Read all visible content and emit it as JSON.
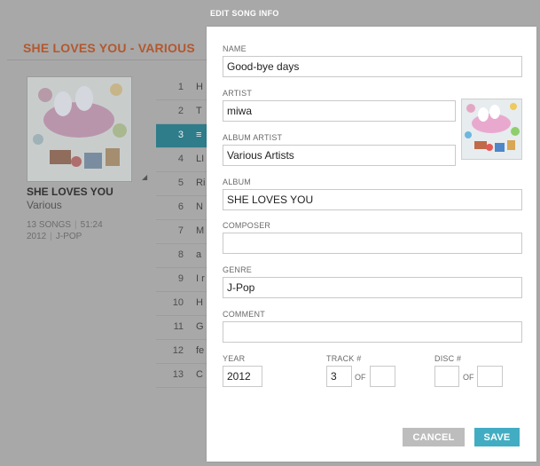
{
  "album_page": {
    "title": "SHE LOVES YOU - VARIOUS",
    "album_name": "SHE LOVES YOU",
    "artist": "Various",
    "songs": "13 SONGS",
    "duration": "51:24",
    "year": "2012",
    "genre": "J-POP",
    "tracks": [
      {
        "num": "1",
        "name": "H"
      },
      {
        "num": "2",
        "name": "T"
      },
      {
        "num": "3",
        "name": "≡"
      },
      {
        "num": "4",
        "name": "LI"
      },
      {
        "num": "5",
        "name": "Ri"
      },
      {
        "num": "6",
        "name": "N"
      },
      {
        "num": "7",
        "name": "M"
      },
      {
        "num": "8",
        "name": "a"
      },
      {
        "num": "9",
        "name": "I r"
      },
      {
        "num": "10",
        "name": "H"
      },
      {
        "num": "11",
        "name": "G"
      },
      {
        "num": "12",
        "name": "fe"
      },
      {
        "num": "13",
        "name": "C"
      }
    ],
    "active_track": 3
  },
  "modal": {
    "title": "EDIT SONG INFO",
    "fields": {
      "name": {
        "label": "NAME",
        "value": "Good-bye days"
      },
      "artist": {
        "label": "ARTIST",
        "value": "miwa"
      },
      "album_artist": {
        "label": "ALBUM ARTIST",
        "value": "Various Artists"
      },
      "album": {
        "label": "ALBUM",
        "value": "SHE LOVES YOU"
      },
      "composer": {
        "label": "COMPOSER",
        "value": ""
      },
      "genre": {
        "label": "GENRE",
        "value": "J-Pop"
      },
      "comment": {
        "label": "COMMENT",
        "value": ""
      },
      "year": {
        "label": "YEAR",
        "value": "2012"
      },
      "track": {
        "label": "TRACK #",
        "value": "3",
        "of_label": "OF",
        "of_value": ""
      },
      "disc": {
        "label": "DISC #",
        "value": "",
        "of_label": "OF",
        "of_value": ""
      }
    },
    "cancel_label": "CANCEL",
    "save_label": "SAVE"
  },
  "colors": {
    "accent": "#42adc2",
    "album_title": "#b2582f",
    "overlay": "#a8a8a8"
  }
}
